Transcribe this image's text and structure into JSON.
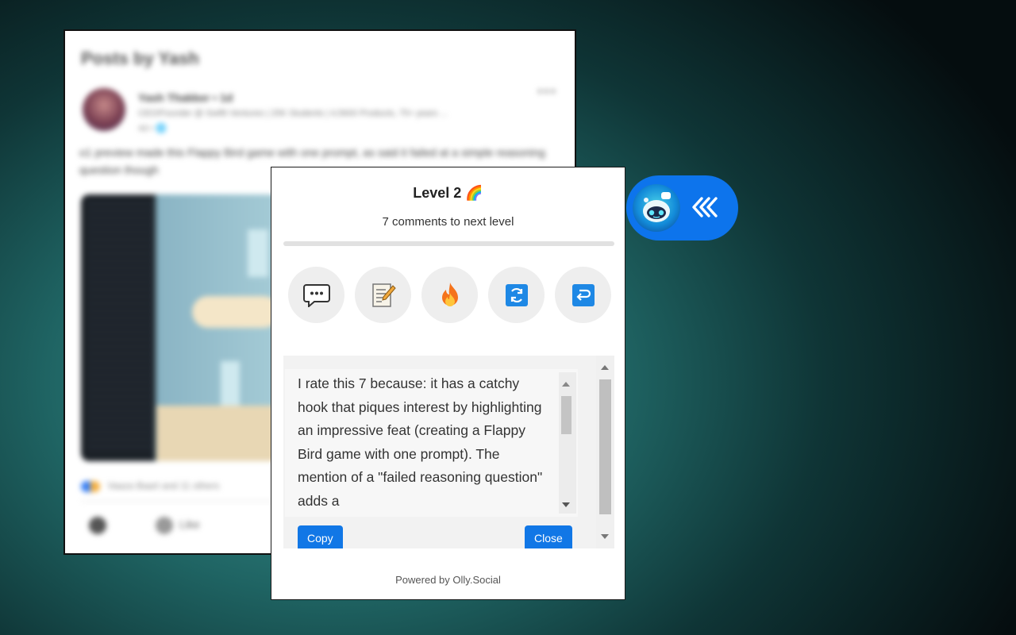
{
  "background_post": {
    "title": "Posts by Yash",
    "author": "Yash Thakker • 1d",
    "headline": "CEO/Founder @ Swiftt Ventures | 25K Students | 4,5600 Products, 75+ years ...",
    "meta": "4d • 🌐",
    "body": "o1 preview made this Flappy Bird game with one prompt, as said it failed at a simple reasoning question though",
    "reactions": "Vaaza Baart and 11 others",
    "like_label": "Like"
  },
  "popup": {
    "level_title": "Level 2 🌈",
    "level_subtitle": "7 comments to next level",
    "progress_fraction": 0,
    "action_icons": [
      "speech-balloon-icon",
      "memo-icon",
      "fire-icon",
      "refresh-icon",
      "return-arrow-icon"
    ],
    "response_text": "I rate this 7 because: it has a catchy hook that piques interest by highlighting an impressive feat (creating a Flappy Bird game with one prompt). The mention of a \"failed reasoning question\" adds a",
    "copy_label": "Copy",
    "close_label": "Close",
    "powered_by": "Powered by Olly.Social"
  },
  "bot_pill": {
    "icon": "robot-avatar-icon",
    "chevrons": "«‹",
    "color": "#0d74ec"
  },
  "colors": {
    "accent_blue": "#1177e6",
    "popup_bg": "#ffffff"
  }
}
